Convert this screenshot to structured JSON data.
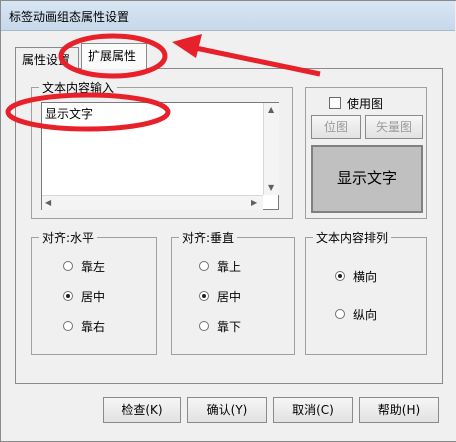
{
  "window": {
    "title": "标签动画组态属性设置"
  },
  "tabs": [
    {
      "label": "属性设置"
    },
    {
      "label": "扩展属性"
    }
  ],
  "text_group": {
    "legend": "文本内容输入",
    "value": "显示文字"
  },
  "image_group": {
    "use_image_label": "使用图",
    "bitmap_button": "位图",
    "vector_button": "矢量图",
    "preview_text": "显示文字"
  },
  "align_h": {
    "legend": "对齐:水平",
    "options": [
      "靠左",
      "居中",
      "靠右"
    ]
  },
  "align_v": {
    "legend": "对齐:垂直",
    "options": [
      "靠上",
      "居中",
      "靠下"
    ]
  },
  "arrange": {
    "legend": "文本内容排列",
    "options": [
      "横向",
      "纵向"
    ]
  },
  "footer": {
    "check": "检查(K)",
    "ok": "确认(Y)",
    "cancel": "取消(C)",
    "help": "帮助(H)"
  },
  "colors": {
    "annotation": "#e8202a",
    "preview_bg": "#c0c0c0"
  }
}
